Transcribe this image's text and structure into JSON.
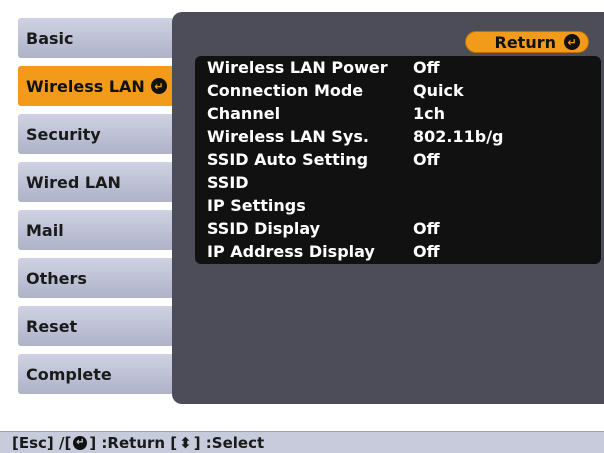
{
  "sidebar": {
    "items": [
      {
        "label": "Basic"
      },
      {
        "label": "Wireless LAN"
      },
      {
        "label": "Security"
      },
      {
        "label": "Wired LAN"
      },
      {
        "label": "Mail"
      },
      {
        "label": "Others"
      },
      {
        "label": "Reset"
      },
      {
        "label": "Complete"
      }
    ],
    "active_index": 1
  },
  "return_button": {
    "label": "Return"
  },
  "settings": [
    {
      "label": "Wireless LAN Power",
      "value": "Off"
    },
    {
      "label": "Connection Mode",
      "value": "Quick"
    },
    {
      "label": "Channel",
      "value": "1ch"
    },
    {
      "label": "Wireless LAN Sys.",
      "value": "802.11b/g"
    },
    {
      "label": "SSID Auto Setting",
      "value": "Off"
    },
    {
      "label": "SSID",
      "value": ""
    },
    {
      "label": "IP Settings",
      "value": ""
    },
    {
      "label": "SSID Display",
      "value": "Off"
    },
    {
      "label": "IP Address Display",
      "value": "Off"
    }
  ],
  "status_bar": {
    "text_esc": "[Esc] /[",
    "text_return": "] :Return  [",
    "text_select": "] :Select"
  },
  "colors": {
    "accent": "#f29a1a",
    "panel": "#4d4d59",
    "nav_bg": "#bfc3d6"
  },
  "icons": {
    "enter": "enter-icon",
    "updown": "up-down-arrow-icon"
  }
}
